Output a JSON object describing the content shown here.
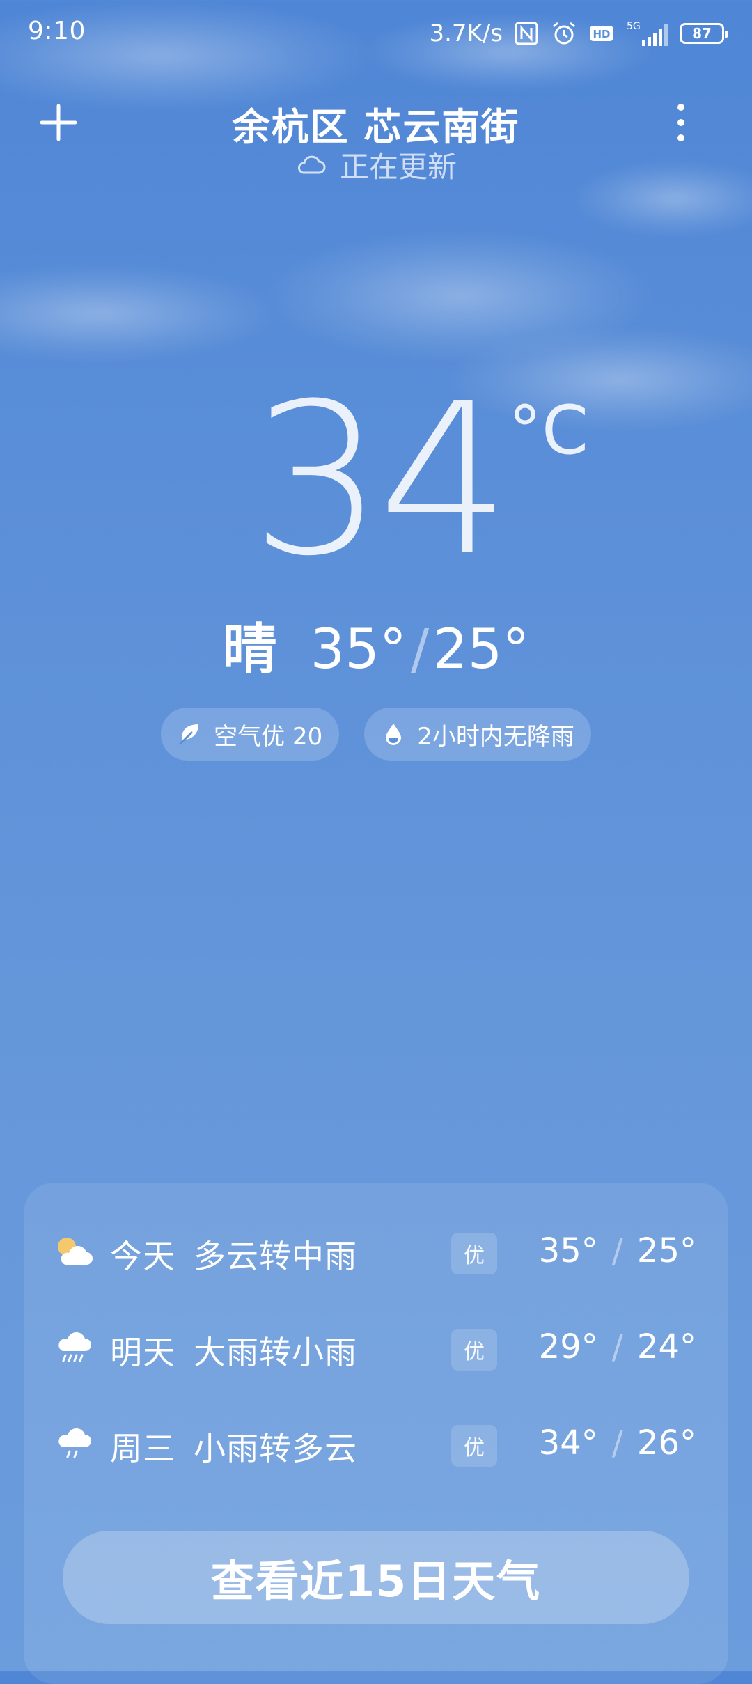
{
  "status_bar": {
    "time": "9:10",
    "net_speed": "3.7K/s",
    "battery": "87",
    "hd_label": "HD",
    "network_label": "5G"
  },
  "header": {
    "location": "余杭区 芯云南街",
    "update_status": "正在更新"
  },
  "current": {
    "temperature": "34",
    "unit": "°C",
    "condition": "晴",
    "high": "35°",
    "low": "25°"
  },
  "chips": {
    "air_quality": "空气优 20",
    "rain": "2小时内无降雨"
  },
  "forecast": [
    {
      "day": "今天",
      "condition": "多云转中雨",
      "aqi": "优",
      "high": "35°",
      "low": "25°",
      "icon": "partly-cloudy-icon"
    },
    {
      "day": "明天",
      "condition": "大雨转小雨",
      "aqi": "优",
      "high": "29°",
      "low": "24°",
      "icon": "heavy-rain-icon"
    },
    {
      "day": "周三",
      "condition": "小雨转多云",
      "aqi": "优",
      "high": "34°",
      "low": "26°",
      "icon": "light-rain-icon"
    }
  ],
  "cta": {
    "label": "查看近15日天气"
  },
  "colors": {
    "sky_top": "#4f86d6",
    "sky_bottom": "#6b9ddd",
    "sun": "#f3c96b"
  }
}
